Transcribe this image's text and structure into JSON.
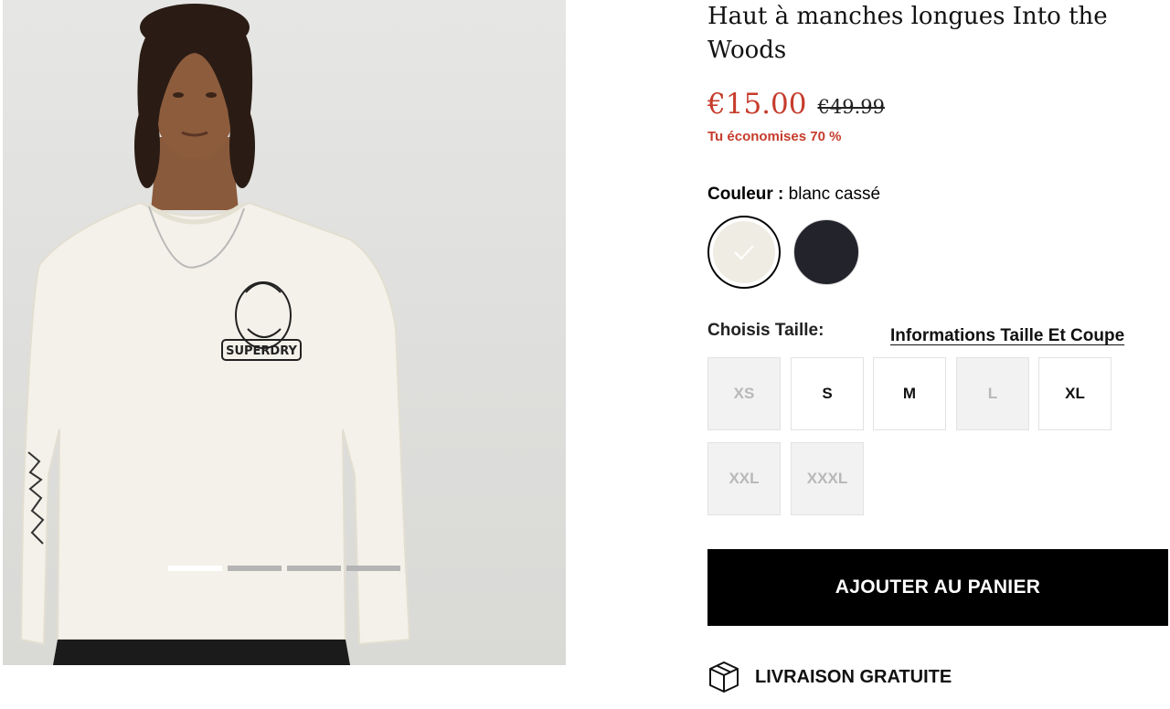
{
  "product": {
    "title": "Haut à manches longues Into the Woods",
    "price_now": "€15.00",
    "price_was": "€49.99",
    "savings": "Tu économises 70 %"
  },
  "gallery": {
    "image_count": 4,
    "active_index": 0
  },
  "colour": {
    "label": "Couleur :",
    "value": "blanc cassé",
    "swatches": [
      {
        "name": "blanc cassé",
        "hex": "#efece4",
        "selected": true
      },
      {
        "name": "noir",
        "hex": "#22232b",
        "selected": false
      }
    ]
  },
  "size": {
    "label": "Choisis Taille:",
    "guide_link": "Informations Taille Et Coupe",
    "options": [
      {
        "label": "XS",
        "available": false
      },
      {
        "label": "S",
        "available": true
      },
      {
        "label": "M",
        "available": true
      },
      {
        "label": "L",
        "available": false
      },
      {
        "label": "XL",
        "available": true
      },
      {
        "label": "XXL",
        "available": false
      },
      {
        "label": "XXXL",
        "available": false
      }
    ]
  },
  "cart": {
    "add_label": "AJOUTER AU PANIER"
  },
  "shipping": {
    "label": "LIVRAISON GRATUITE",
    "icon": "box-icon"
  },
  "colors": {
    "sale_red": "#c63c2c",
    "button_black": "#000000"
  }
}
